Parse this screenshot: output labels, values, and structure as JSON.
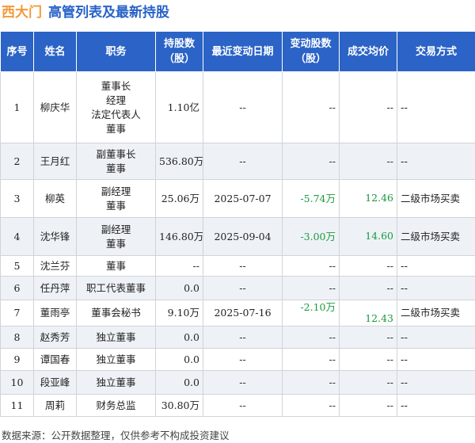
{
  "title": {
    "brand": "西大门",
    "main": "高管列表及最新持股"
  },
  "columns": [
    "序号",
    "姓名",
    "职务",
    "持股数\n（股）",
    "最近变动日期",
    "变动股数\n（股）",
    "成交均价",
    "交易方式"
  ],
  "rows": [
    {
      "no": "1",
      "name": "柳庆华",
      "positions": [
        "董事长",
        "经理",
        "法定代表人",
        "董事"
      ],
      "shares": "1.10亿",
      "date": "--",
      "change": "--",
      "price": "--",
      "method": "--"
    },
    {
      "no": "2",
      "name": "王月红",
      "positions": [
        "副董事长",
        "董事"
      ],
      "shares": "536.80万",
      "date": "--",
      "change": "--",
      "price": "--",
      "method": "--"
    },
    {
      "no": "3",
      "name": "柳英",
      "positions": [
        "副经理",
        "董事"
      ],
      "shares": "25.06万",
      "date": "2025-07-07",
      "change": "-5.74万",
      "price": "12.46",
      "method": "二级市场买卖"
    },
    {
      "no": "4",
      "name": "沈华锋",
      "positions": [
        "副经理",
        "董事"
      ],
      "shares": "146.80万",
      "date": "2025-09-04",
      "change": "-3.00万",
      "price": "14.60",
      "method": "二级市场买卖"
    },
    {
      "no": "5",
      "name": "沈兰芬",
      "positions": [
        "董事"
      ],
      "shares": "--",
      "date": "--",
      "change": "--",
      "price": "--",
      "method": "--"
    },
    {
      "no": "6",
      "name": "任丹萍",
      "positions": [
        "职工代表董事"
      ],
      "shares": "0.0",
      "date": "--",
      "change": "--",
      "price": "--",
      "method": "--"
    },
    {
      "no": "7",
      "name": "董雨亭",
      "positions": [
        "董事会秘书"
      ],
      "shares": "9.10万",
      "date": "2025-07-16",
      "change": "-2.10万",
      "price": "12.43",
      "method": "二级市场买卖"
    },
    {
      "no": "8",
      "name": "赵秀芳",
      "positions": [
        "独立董事"
      ],
      "shares": "0.0",
      "date": "--",
      "change": "--",
      "price": "--",
      "method": "--"
    },
    {
      "no": "9",
      "name": "谭国春",
      "positions": [
        "独立董事"
      ],
      "shares": "0.0",
      "date": "--",
      "change": "--",
      "price": "--",
      "method": "--"
    },
    {
      "no": "10",
      "name": "段亚峰",
      "positions": [
        "独立董事"
      ],
      "shares": "0.0",
      "date": "--",
      "change": "--",
      "price": "--",
      "method": "--"
    },
    {
      "no": "11",
      "name": "周莉",
      "positions": [
        "财务总监"
      ],
      "shares": "30.80万",
      "date": "--",
      "change": "--",
      "price": "--",
      "method": "--"
    }
  ],
  "footnote": "数据来源：公开数据整理，仅供参考不构成投资建议",
  "colors": {
    "header_bg": "#2b63c6",
    "brand": "#f39a3a",
    "title": "#2862c8",
    "positive_price": "#1a9a3c",
    "change": "#1a9a3c"
  }
}
